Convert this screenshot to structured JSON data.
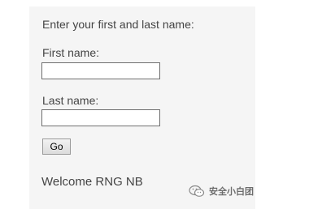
{
  "form": {
    "instruction": "Enter your first and last name:",
    "first_name_label": "First name:",
    "first_name_value": "",
    "last_name_label": "Last name:",
    "last_name_value": "",
    "submit_label": "Go"
  },
  "result": {
    "welcome_text": "Welcome RNG NB"
  },
  "watermark": {
    "text": "安全小白团",
    "icon": "wechat-icon"
  },
  "colors": {
    "panel_background": "#f5f5f5",
    "text": "#444444",
    "input_border": "#6f6f6f"
  }
}
